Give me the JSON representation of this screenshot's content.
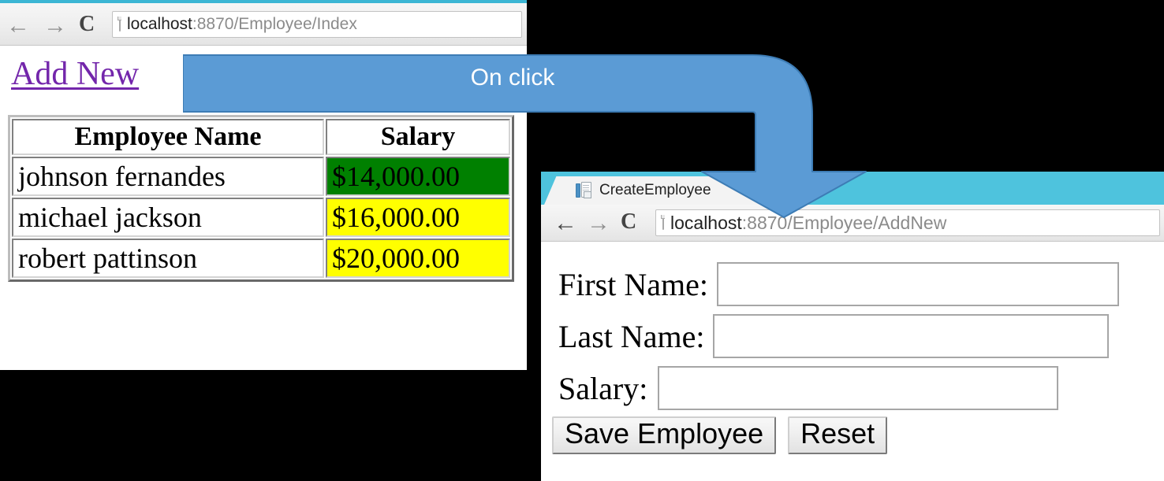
{
  "window_index": {
    "browser": {
      "back_icon": "←",
      "forward_icon": "→",
      "reload_icon": "C",
      "page_icon": "page-icon",
      "url_host": "localhost",
      "url_rest": ":8870/Employee/Index"
    },
    "add_new_link": "Add New",
    "table": {
      "headers": [
        "Employee Name",
        "Salary"
      ],
      "rows": [
        {
          "name": "johnson fernandes",
          "salary": "$14,000.00",
          "highlight": "#008000"
        },
        {
          "name": "michael jackson",
          "salary": "$16,000.00",
          "highlight": "#ffff00"
        },
        {
          "name": "robert pattinson",
          "salary": "$20,000.00",
          "highlight": "#ffff00"
        }
      ]
    }
  },
  "annotation": {
    "label": "On click",
    "arrow_color": "#5b9bd5",
    "arrow_stroke": "#3d7cb5",
    "label_color": "#ffffff"
  },
  "window_addnew": {
    "tab_title": "CreateEmployee",
    "browser": {
      "back_icon": "←",
      "forward_icon": "→",
      "reload_icon": "C",
      "page_icon": "page-icon",
      "url_host": "localhost",
      "url_rest": ":8870/Employee/AddNew"
    },
    "form": {
      "fields": [
        {
          "label": "First Name:",
          "value": "",
          "placeholder": ""
        },
        {
          "label": "Last Name:",
          "value": "",
          "placeholder": ""
        },
        {
          "label": "Salary:",
          "value": "",
          "placeholder": ""
        }
      ],
      "save_button": "Save Employee",
      "reset_button": "Reset"
    }
  }
}
